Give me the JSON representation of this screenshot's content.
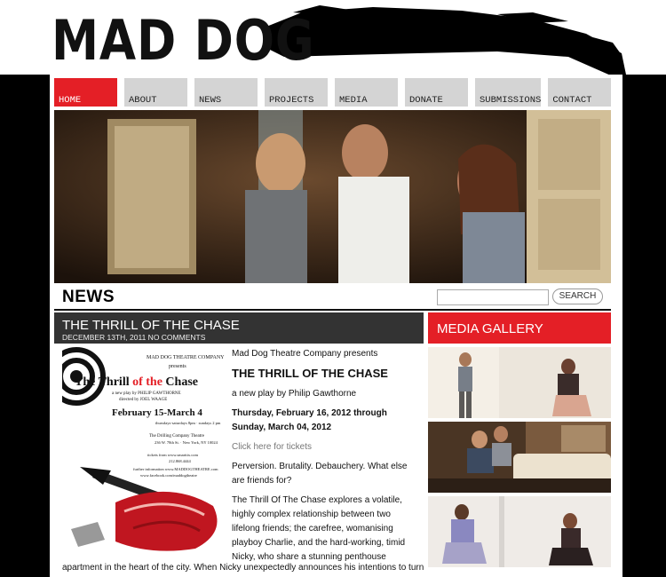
{
  "logo": "MAD DOG",
  "nav": [
    "Home",
    "About",
    "News",
    "Projects",
    "Media",
    "Donate",
    "Submissions",
    "Contact"
  ],
  "news_heading": "NEWS",
  "search": {
    "button": "SEARCH",
    "placeholder": ""
  },
  "post": {
    "title": "THE THRILL OF THE CHASE",
    "meta": "DECEMBER 13TH, 2011 NO COMMENTS",
    "presenter": "Mad Dog Theatre Company presents",
    "play_title": "THE THRILL OF THE CHASE",
    "byline": "a new play by Philip Gawthorne",
    "dates": "Thursday, February 16, 2012 through Sunday, March 04, 2012",
    "ticket_link": "Click here for tickets",
    "tagline": "Perversion. Brutality. Debauchery. What else are friends for?",
    "summary": "The Thrill Of The Chase explores a volatile, highly complex relationship between two lifelong friends; the carefree, womanising playboy Charlie, and the hard-working, timid Nicky, who share a stunning penthouse",
    "summary_cont": "apartment in the heart of the city. When Nicky unexpectedly announces his intentions to turn"
  },
  "poster": {
    "company": "MAD DOG THEATRE COMPANY",
    "presents": "presents",
    "title_a": "The Thrill ",
    "title_b": "of the",
    "title_c": " Chase",
    "credit1": "a new play by PHILIP GAWTHORNE",
    "credit2": "directed by JOEL WAAGE",
    "dates": "February 15-March 4",
    "schedule": "thursdays-saturdays 8pm · sundays 2 pm",
    "venue": "The Drilling Company Theatre",
    "address": "236 W. 78th St. · New York, NY 10024",
    "tickets": "tickets from www.smarttix.com",
    "phone": "212.868.4444",
    "info": "further information www.MADDOGTHEATRE.com",
    "fb": "www.facebook.com/maddogtheatre"
  },
  "media_gallery": {
    "title": "MEDIA GALLERY"
  },
  "colors": {
    "accent": "#e41f26",
    "dark_header": "#333333",
    "nav_inactive": "#d4d4d4"
  }
}
